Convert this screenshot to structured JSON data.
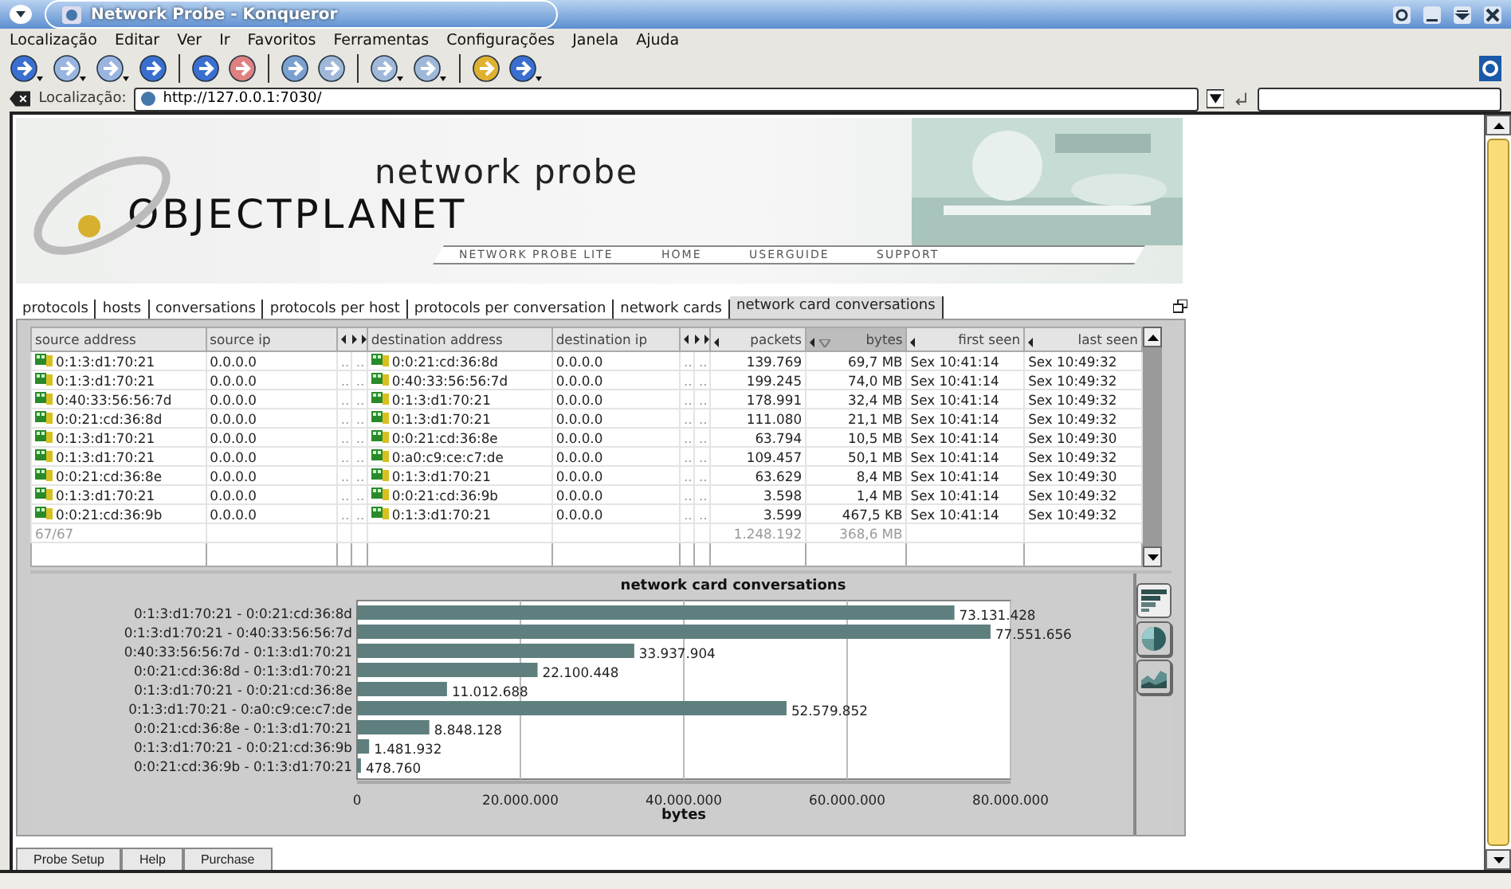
{
  "window": {
    "title": "Network Probe - Konqueror"
  },
  "menu": [
    "Localização",
    "Editar",
    "Ver",
    "Ir",
    "Favoritos",
    "Ferramentas",
    "Configurações",
    "Janela",
    "Ajuda"
  ],
  "location": {
    "label": "Localização:",
    "url": "http://127.0.0.1:7030/"
  },
  "header": {
    "product": "network probe",
    "brand": "OBJECTPLANET",
    "nav": [
      "NETWORK PROBE LITE",
      "HOME",
      "USERGUIDE",
      "SUPPORT"
    ]
  },
  "tabs": [
    {
      "label": "protocols",
      "selected": false
    },
    {
      "label": "hosts",
      "selected": false
    },
    {
      "label": "conversations",
      "selected": false
    },
    {
      "label": "protocols per host",
      "selected": false
    },
    {
      "label": "protocols per conversation",
      "selected": false
    },
    {
      "label": "network cards",
      "selected": false
    },
    {
      "label": "network card conversations",
      "selected": true
    }
  ],
  "table": {
    "columns": [
      {
        "label": "source address",
        "sorted": false
      },
      {
        "label": "source ip",
        "sorted": false
      },
      {
        "label": "destination address",
        "sorted": false
      },
      {
        "label": "destination ip",
        "sorted": false
      },
      {
        "label": "packets",
        "sorted": false
      },
      {
        "label": "bytes",
        "sorted": true
      },
      {
        "label": "first seen",
        "sorted": false
      },
      {
        "label": "last seen",
        "sorted": false
      }
    ],
    "rows": [
      {
        "source_address": "0:1:3:d1:70:21",
        "source_ip": "0.0.0.0",
        "source_flags": [
          "..",
          ".."
        ],
        "destination_address": "0:0:21:cd:36:8d",
        "destination_ip": "0.0.0.0",
        "destination_flags": [
          "..",
          ".."
        ],
        "packets": "139.769",
        "bytes": "69,7 MB",
        "first_seen": "Sex 10:41:14",
        "last_seen": "Sex 10:49:32"
      },
      {
        "source_address": "0:1:3:d1:70:21",
        "source_ip": "0.0.0.0",
        "source_flags": [
          "..",
          ".."
        ],
        "destination_address": "0:40:33:56:56:7d",
        "destination_ip": "0.0.0.0",
        "destination_flags": [
          "..",
          ".."
        ],
        "packets": "199.245",
        "bytes": "74,0 MB",
        "first_seen": "Sex 10:41:14",
        "last_seen": "Sex 10:49:32"
      },
      {
        "source_address": "0:40:33:56:56:7d",
        "source_ip": "0.0.0.0",
        "source_flags": [
          "..",
          ".."
        ],
        "destination_address": "0:1:3:d1:70:21",
        "destination_ip": "0.0.0.0",
        "destination_flags": [
          "..",
          ".."
        ],
        "packets": "178.991",
        "bytes": "32,4 MB",
        "first_seen": "Sex 10:41:14",
        "last_seen": "Sex 10:49:32"
      },
      {
        "source_address": "0:0:21:cd:36:8d",
        "source_ip": "0.0.0.0",
        "source_flags": [
          "..",
          ".."
        ],
        "destination_address": "0:1:3:d1:70:21",
        "destination_ip": "0.0.0.0",
        "destination_flags": [
          "..",
          ".."
        ],
        "packets": "111.080",
        "bytes": "21,1 MB",
        "first_seen": "Sex 10:41:14",
        "last_seen": "Sex 10:49:32"
      },
      {
        "source_address": "0:1:3:d1:70:21",
        "source_ip": "0.0.0.0",
        "source_flags": [
          "..",
          ".."
        ],
        "destination_address": "0:0:21:cd:36:8e",
        "destination_ip": "0.0.0.0",
        "destination_flags": [
          "..",
          ".."
        ],
        "packets": "63.794",
        "bytes": "10,5 MB",
        "first_seen": "Sex 10:41:14",
        "last_seen": "Sex 10:49:30"
      },
      {
        "source_address": "0:1:3:d1:70:21",
        "source_ip": "0.0.0.0",
        "source_flags": [
          "..",
          ".."
        ],
        "destination_address": "0:a0:c9:ce:c7:de",
        "destination_ip": "0.0.0.0",
        "destination_flags": [
          "..",
          ".."
        ],
        "packets": "109.457",
        "bytes": "50,1 MB",
        "first_seen": "Sex 10:41:14",
        "last_seen": "Sex 10:49:32"
      },
      {
        "source_address": "0:0:21:cd:36:8e",
        "source_ip": "0.0.0.0",
        "source_flags": [
          "..",
          ".."
        ],
        "destination_address": "0:1:3:d1:70:21",
        "destination_ip": "0.0.0.0",
        "destination_flags": [
          "..",
          ".."
        ],
        "packets": "63.629",
        "bytes": "8,4 MB",
        "first_seen": "Sex 10:41:14",
        "last_seen": "Sex 10:49:30"
      },
      {
        "source_address": "0:1:3:d1:70:21",
        "source_ip": "0.0.0.0",
        "source_flags": [
          "..",
          ".."
        ],
        "destination_address": "0:0:21:cd:36:9b",
        "destination_ip": "0.0.0.0",
        "destination_flags": [
          "..",
          ".."
        ],
        "packets": "3.598",
        "bytes": "1,4 MB",
        "first_seen": "Sex 10:41:14",
        "last_seen": "Sex 10:49:32"
      },
      {
        "source_address": "0:0:21:cd:36:9b",
        "source_ip": "0.0.0.0",
        "source_flags": [
          "..",
          ".."
        ],
        "destination_address": "0:1:3:d1:70:21",
        "destination_ip": "0.0.0.0",
        "destination_flags": [
          "..",
          ".."
        ],
        "packets": "3.599",
        "bytes": "467,5 KB",
        "first_seen": "Sex 10:41:14",
        "last_seen": "Sex 10:49:32"
      }
    ],
    "summary": {
      "count": "67/67",
      "packets": "1.248.192",
      "bytes": "368,6 MB"
    }
  },
  "chart": {
    "views": [
      {
        "kind": "bar",
        "selected": true
      },
      {
        "kind": "pie",
        "selected": false
      },
      {
        "kind": "area",
        "selected": false
      }
    ],
    "chart_data": {
      "type": "bar",
      "orientation": "horizontal",
      "title": "network card conversations",
      "xlabel": "bytes",
      "categories": [
        "0:1:3:d1:70:21 - 0:0:21:cd:36:8d",
        "0:1:3:d1:70:21 - 0:40:33:56:56:7d",
        "0:40:33:56:56:7d - 0:1:3:d1:70:21",
        "0:0:21:cd:36:8d - 0:1:3:d1:70:21",
        "0:1:3:d1:70:21 - 0:0:21:cd:36:8e",
        "0:1:3:d1:70:21 - 0:a0:c9:ce:c7:de",
        "0:0:21:cd:36:8e - 0:1:3:d1:70:21",
        "0:1:3:d1:70:21 - 0:0:21:cd:36:9b",
        "0:0:21:cd:36:9b - 0:1:3:d1:70:21"
      ],
      "series": [
        {
          "color": "#5f7f7f",
          "values": [
            73131428,
            77551656,
            33937904,
            22100448,
            11012688,
            52579852,
            8848128,
            1481932,
            478760
          ]
        }
      ],
      "value_labels": [
        "73.131.428",
        "77.551.656",
        "33.937.904",
        "22.100.448",
        "11.012.688",
        "52.579.852",
        "8.848.128",
        "1.481.932",
        "478.760"
      ],
      "xlim": [
        0,
        80000000
      ],
      "grid": true,
      "xticks": [
        {
          "value": 0,
          "label": "0"
        },
        {
          "value": 20000000,
          "label": "20.000.000"
        },
        {
          "value": 40000000,
          "label": "40.000.000"
        },
        {
          "value": 60000000,
          "label": "60.000.000"
        },
        {
          "value": 80000000,
          "label": "80.000.000"
        }
      ]
    }
  },
  "bottom_tabs": [
    "Probe Setup",
    "Help",
    "Purchase"
  ]
}
